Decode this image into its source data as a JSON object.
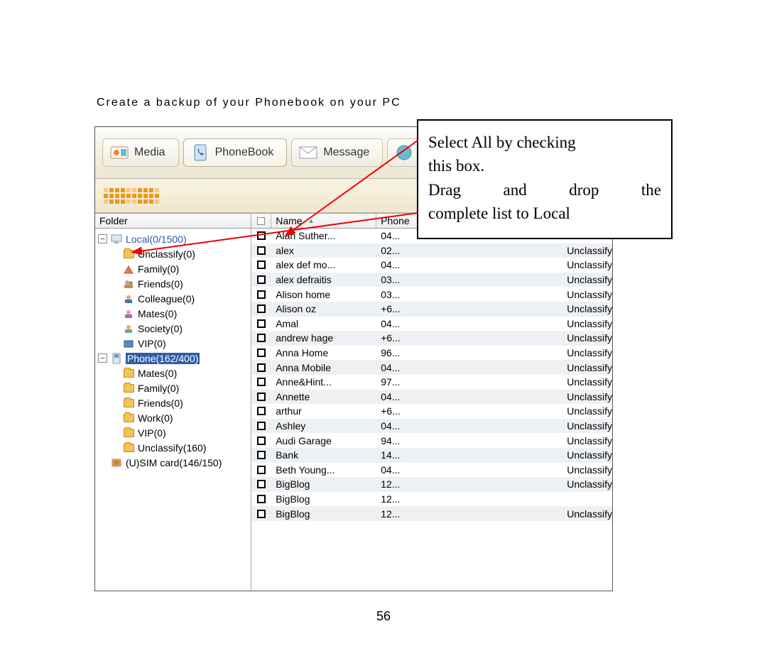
{
  "heading": "Create a backup of your Phonebook on your PC",
  "tabs": {
    "media": "Media",
    "phonebook": "PhoneBook",
    "message": "Message",
    "internet": "In"
  },
  "folderHeader": "Folder",
  "tree": {
    "local": "Local(0/1500)",
    "local_children": {
      "unclassify": "Unclassify(0)",
      "family": "Family(0)",
      "friends": "Friends(0)",
      "colleague": "Colleague(0)",
      "mates": "Mates(0)",
      "society": "Society(0)",
      "vip": "VIP(0)"
    },
    "phone": "Phone(162/400)",
    "phone_children": {
      "mates": "Mates(0)",
      "family": "Family(0)",
      "friends": "Friends(0)",
      "work": "Work(0)",
      "vip": "VIP(0)",
      "unclassify": "Unclassify(160)"
    },
    "sim": "(U)SIM card(146/150)"
  },
  "listHeaders": {
    "name": "Name",
    "phone": "Phone"
  },
  "rows": [
    {
      "name": "Alan Suther...",
      "phone": "04...",
      "type": ""
    },
    {
      "name": "alex",
      "phone": "02...",
      "type": "Unclassify"
    },
    {
      "name": "alex def  mo...",
      "phone": "04...",
      "type": "Unclassify"
    },
    {
      "name": "alex defraitis",
      "phone": "03...",
      "type": "Unclassify"
    },
    {
      "name": "Alison home",
      "phone": "03...",
      "type": "Unclassify"
    },
    {
      "name": "Alison oz",
      "phone": "+6...",
      "type": "Unclassify"
    },
    {
      "name": "Amal",
      "phone": "04...",
      "type": "Unclassify"
    },
    {
      "name": "andrew hage",
      "phone": "+6...",
      "type": "Unclassify"
    },
    {
      "name": "Anna Home",
      "phone": "96...",
      "type": "Unclassify"
    },
    {
      "name": "Anna Mobile",
      "phone": "04...",
      "type": "Unclassify"
    },
    {
      "name": "Anne&Hint...",
      "phone": "97...",
      "type": "Unclassify"
    },
    {
      "name": "Annette",
      "phone": "04...",
      "type": "Unclassify"
    },
    {
      "name": "arthur",
      "phone": "+6...",
      "type": "Unclassify"
    },
    {
      "name": "Ashley",
      "phone": "04...",
      "type": "Unclassify"
    },
    {
      "name": "Audi Garage",
      "phone": "94...",
      "type": "Unclassify"
    },
    {
      "name": "Bank",
      "phone": "14...",
      "type": "Unclassify"
    },
    {
      "name": "Beth Young...",
      "phone": "04...",
      "type": "Unclassify"
    },
    {
      "name": "BigBlog",
      "phone": "12...",
      "type": "Unclassify"
    },
    {
      "name": "BigBlog",
      "phone": "12...",
      "type": ""
    },
    {
      "name": "BigBlog",
      "phone": "12...",
      "type": "Unclassify"
    }
  ],
  "callout": {
    "line1": "Select All by checking",
    "line2": "this box.",
    "line3": "Drag and drop the",
    "line4": "complete list to Local"
  },
  "pageNumber": "56"
}
